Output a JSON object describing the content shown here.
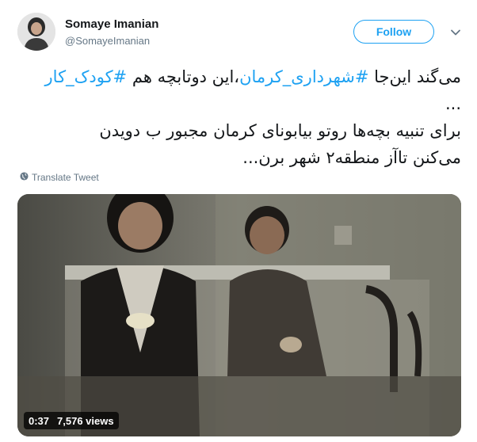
{
  "author": {
    "display_name": "Somaye Imanian",
    "handle": "@SomayeImanian"
  },
  "follow_label": "Follow",
  "tweet": {
    "line1_prefix": "می‌گند این‌جا ",
    "hashtag1": "#شهرداری_کرمان",
    "line1_middle": "،این دوتابچه هم ",
    "hashtag2": "#کودک_کار",
    "line2": "...",
    "line3": "برای تنبیه بچه‌ها روتو بیابونای کرمان مجبور ب دویدن",
    "line4": "می‌کنن تاآز منطقه۲ شهر برن..."
  },
  "translate_label": "Translate Tweet",
  "video": {
    "duration": "0:37",
    "views": "7,576 views"
  },
  "colors": {
    "accent": "#1da1f2",
    "text": "#14171a",
    "secondary": "#657786"
  },
  "icons": [
    "globe-icon",
    "chevron-down-icon"
  ]
}
